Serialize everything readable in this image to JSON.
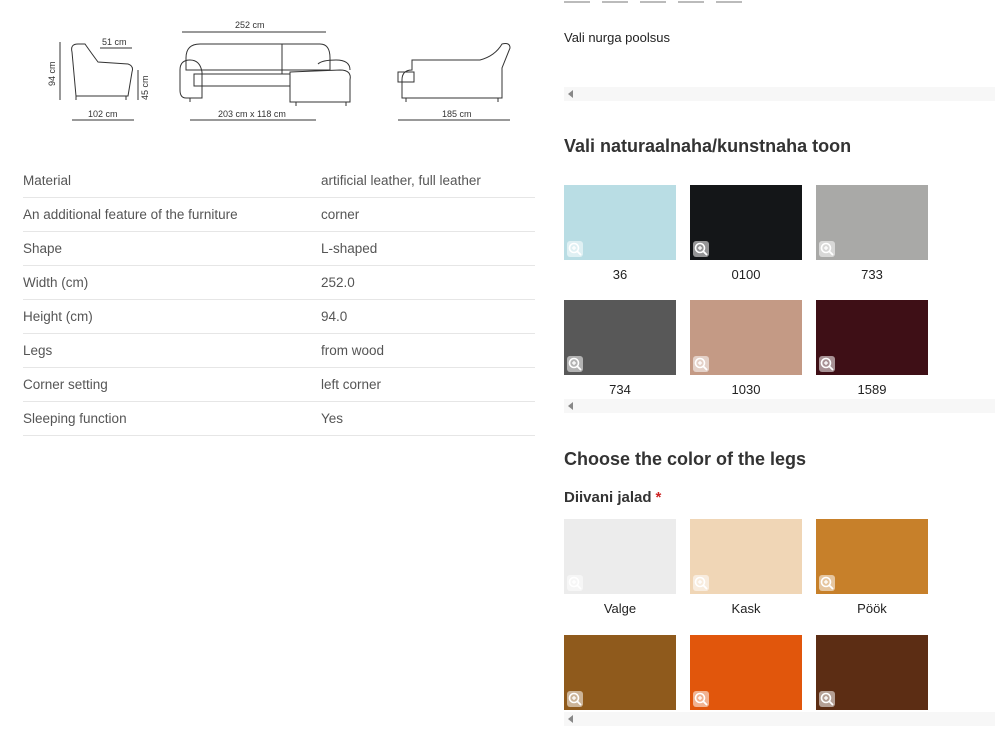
{
  "dimensions": {
    "height_total": "94 cm",
    "arm_width": "51 cm",
    "seat_height": "45 cm",
    "depth": "102 cm",
    "total_width": "252 cm",
    "footprint": "203 cm x 118 cm",
    "chaise_length": "185 cm"
  },
  "specs": [
    {
      "key": "Material",
      "value": "artificial leather, full leather"
    },
    {
      "key": "An additional feature of the furniture",
      "value": "corner"
    },
    {
      "key": "Shape",
      "value": "L-shaped"
    },
    {
      "key": "Width (cm)",
      "value": "252.0"
    },
    {
      "key": "Height (cm)",
      "value": "94.0"
    },
    {
      "key": "Legs",
      "value": "from wood"
    },
    {
      "key": "Corner setting",
      "value": "left corner"
    },
    {
      "key": "Sleeping function",
      "value": "Yes"
    }
  ],
  "corner": {
    "label": "Vali nurga poolsus"
  },
  "leather": {
    "title": "Vali naturaalnaha/kunstnaha toon",
    "swatches": [
      {
        "name": "36",
        "color": "#b9dde4"
      },
      {
        "name": "0100",
        "color": "#141618"
      },
      {
        "name": "733",
        "color": "#a9a9a7"
      },
      {
        "name": "734",
        "color": "#585858"
      },
      {
        "name": "1030",
        "color": "#c49a85"
      },
      {
        "name": "1589",
        "color": "#3e0f16"
      }
    ]
  },
  "legs": {
    "title": "Choose the color of the legs",
    "group_label": "Diivani jalad",
    "required_mark": "*",
    "swatches": [
      {
        "name": "Valge",
        "color": "#ececec"
      },
      {
        "name": "Kask",
        "color": "#f0d6b6"
      },
      {
        "name": "Pöök",
        "color": "#c7802a"
      },
      {
        "name": "",
        "color": "#8f5a1c"
      },
      {
        "name": "",
        "color": "#e1560c"
      },
      {
        "name": "",
        "color": "#5c2d14"
      }
    ]
  }
}
